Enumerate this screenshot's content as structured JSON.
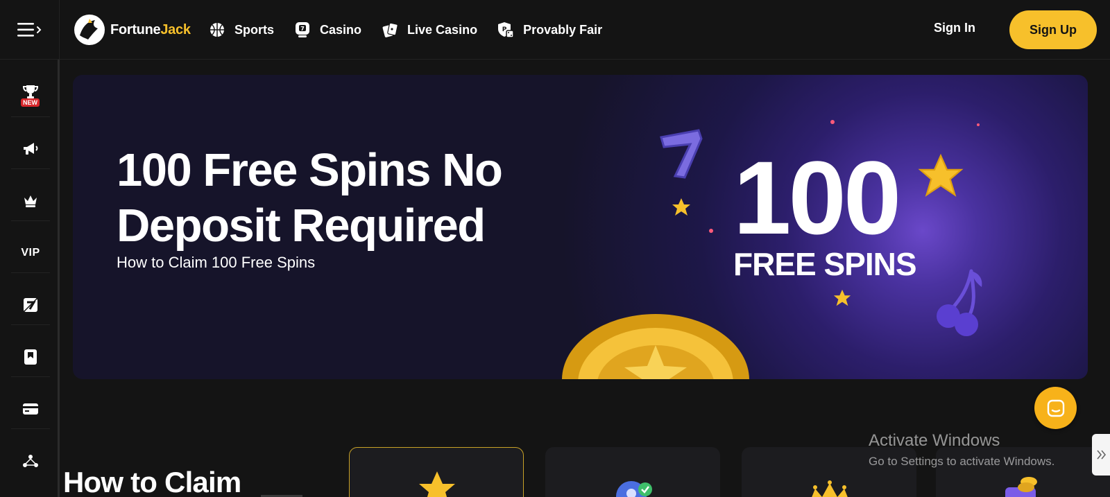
{
  "header": {
    "logo": {
      "prefix": "Fortune",
      "accent": "Jack"
    },
    "nav": [
      {
        "label": "Sports",
        "icon": "basketball-icon"
      },
      {
        "label": "Casino",
        "icon": "slot-machine-icon"
      },
      {
        "label": "Live Casino",
        "icon": "playing-cards-icon"
      },
      {
        "label": "Provably Fair",
        "icon": "shield-dice-icon"
      }
    ],
    "sign_in": "Sign In",
    "sign_up": "Sign Up"
  },
  "sidebar": {
    "items": [
      {
        "icon": "trophy-icon",
        "badge": "NEW"
      },
      {
        "icon": "megaphone-icon"
      },
      {
        "icon": "crown-icon"
      },
      {
        "label": "VIP"
      },
      {
        "icon": "slots-seven-icon"
      },
      {
        "icon": "bookmark-card-icon"
      },
      {
        "icon": "credit-card-icon"
      },
      {
        "icon": "network-icon"
      }
    ]
  },
  "banner": {
    "title": "100 Free Spins No Deposit Required",
    "subtitle": "How to Claim 100 Free Spins",
    "graphic_number": "100",
    "graphic_text": "FREE SPINS"
  },
  "section": {
    "title": "How to Claim"
  },
  "watermark": {
    "line1": "Activate Windows",
    "line2": "Go to Settings to activate Windows."
  },
  "colors": {
    "accent": "#f7c02b",
    "background": "#141414",
    "banner": "#2b2069",
    "badge": "#d6262b"
  }
}
